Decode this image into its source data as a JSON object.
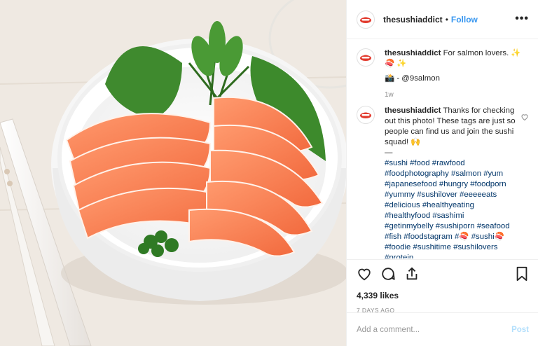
{
  "post": {
    "username": "thesushiaddict",
    "follow_label": "Follow",
    "more_label": "•••",
    "caption": {
      "username": "thesushiaddict",
      "text": "For salmon lovers. ✨ 🍣 ✨",
      "credit": "📸 - @9salmon",
      "time": "1w"
    },
    "reply": {
      "username": "thesushiaddict",
      "text": "Thanks for checking out this photo! These tags are just so people can find us and join the sushi squad! 🙌",
      "divider": "—",
      "hashtags": [
        "#sushi #food #rawfood",
        "#foodphotography #salmon #yum",
        "#japanesefood #hungry #foodporn",
        "#yummy #sushilover #eeeeeats",
        "#delicious #healthyeating",
        "#healthyfood #sashimi",
        "#getinmybelly #sushiporn #seafood",
        "#fish #foodstagram #🍣  #sushi🍣",
        "#foodie #sushitime #sushilovers",
        "#protein"
      ]
    },
    "likes": "4,339 likes",
    "posted": "7 DAYS AGO",
    "comment_placeholder": "Add a comment...",
    "post_label": "Post"
  },
  "icons": {
    "avatar": "sushi-logo-icon",
    "like": "heart-icon",
    "comment": "comment-icon",
    "share": "share-icon",
    "save": "bookmark-icon"
  },
  "colors": {
    "link": "#3897f0",
    "hashtag": "#003569",
    "muted": "#8e8e8e",
    "post_disabled": "#b2dffc",
    "salmon": "#f47a4f"
  }
}
